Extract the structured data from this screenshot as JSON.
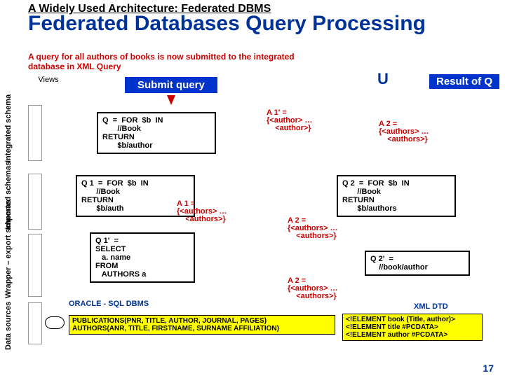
{
  "titles": {
    "arch_small": "A Widely Used Architecture:",
    "arch_sub": " Federated DBMS",
    "main": "Federated Databases Query Processing"
  },
  "intro": {
    "line1": "A query for all authors of books is now submitted to the integrated",
    "line2": "database in XML Query"
  },
  "labels": {
    "views": "Views",
    "submit": "Submit  query",
    "integrated": "Integrated schema",
    "imported": "Imported schemas",
    "wrapper": "Wrapper – export schemas",
    "sources": "Data sources"
  },
  "queries": {
    "q_main": "Q  =  FOR  $b  IN\n       //Book\nRETURN\n       $b/author",
    "q1": "Q 1  =  FOR  $b  IN\n       //Book\nRETURN\n       $b/auth",
    "q2": "Q 2  =  FOR  $b  IN\n       //Book\nRETURN\n       $b/authors",
    "q1p": "Q 1'  =\nSELECT\n   a. name\nFROM\n   AUTHORS a",
    "q2p": "Q 2'  =\n    //book/author"
  },
  "notes": {
    "a1p": "A 1' =\n{<author> …\n    <author>}",
    "a2_top": "A 2 =\n{<authors> …\n    <authors>}",
    "a1": "A 1 =\n{<authors> …\n    <authors>}",
    "a2_mid": "A 2 =\n{<authors> …\n    <authors>}",
    "a2_low": "A 2 =\n{<authors> …\n    <authors>}"
  },
  "sources": {
    "oracle": "ORACLE - SQL DBMS",
    "pubs": "PUBLICATIONS(PNR, TITLE, AUTHOR, JOURNAL, PAGES)\nAUTHORS(ANR, TITLE, FIRSTNAME, SURNAME AFFILIATION)",
    "dtd_label": "XML DTD",
    "dtd": "<!ELEMENT book (Title, author)>\n<!ELEMENT title #PCDATA>\n<!ELEMENT author #PCDATA>"
  },
  "result": "Result of Q",
  "op": "U",
  "page": "17"
}
